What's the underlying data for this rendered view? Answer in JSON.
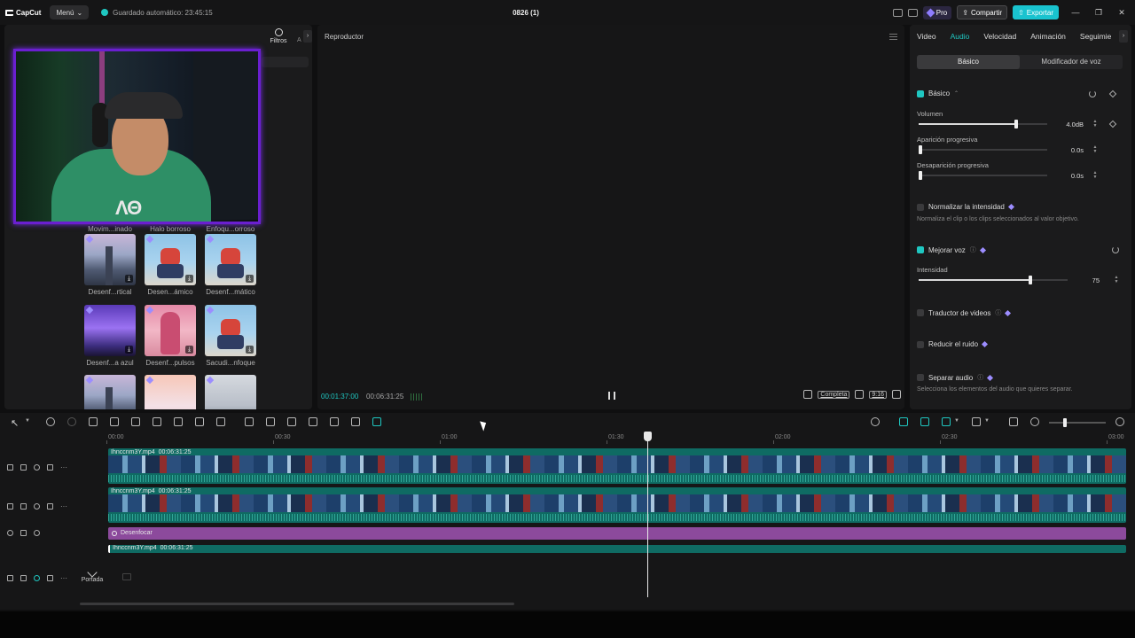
{
  "topbar": {
    "logo_text": "CapCut",
    "menu_label": "Menú",
    "autosave_text": "Guardado automático: 23:45:15",
    "project_title": "0826 (1)",
    "pro_label": "Pro",
    "share_label": "Compartir",
    "export_label": "Exportar"
  },
  "left_panel": {
    "filters_tab": "Filtros",
    "next_tab_initial": "A",
    "effects": [
      {
        "label": "Movim...inado",
        "style": "t-focus"
      },
      {
        "label": "Halo borroso",
        "style": "t-halo"
      },
      {
        "label": "Enfoqu...orroso",
        "style": "t-focus"
      },
      {
        "label": "Desenf...rtical",
        "style": "t-city"
      },
      {
        "label": "Desen...ámico",
        "style": "t-boy"
      },
      {
        "label": "Desenf...mático",
        "style": "t-boy"
      },
      {
        "label": "Desenf...a azul",
        "style": "t-crowd"
      },
      {
        "label": "Desenf...pulsos",
        "style": "t-girl"
      },
      {
        "label": "Sacudi...nfoque",
        "style": "t-boy"
      },
      {
        "label": "",
        "style": "t-city"
      },
      {
        "label": "",
        "style": "t-sunset"
      },
      {
        "label": "",
        "style": "t-room"
      }
    ],
    "hoodie_text": "ΛΘ"
  },
  "player": {
    "title": "Reproductor",
    "current_time": "00:01:37:00",
    "total_time": "00:06:31:25",
    "full_label": "Completa",
    "ratio_label": "9:16"
  },
  "right_panel": {
    "tabs": [
      "Video",
      "Audio",
      "Velocidad",
      "Animación",
      "Seguimie"
    ],
    "active_tab": "Audio",
    "segments": [
      "Básico",
      "Modificador de voz"
    ],
    "basic_section": "Básico",
    "volume_label": "Volumen",
    "volume_value": "4.0dB",
    "volume_level": 0.76,
    "fade_in_label": "Aparición progresiva",
    "fade_in_value": "0.0s",
    "fade_out_label": "Desaparición progresiva",
    "fade_out_value": "0.0s",
    "normalize_label": "Normalizar la intensidad",
    "normalize_desc": "Normaliza el clip o los clips seleccionados al valor objetivo.",
    "enhance_label": "Mejorar voz",
    "intensity_label": "Intensidad",
    "intensity_value": "75",
    "intensity_level": 0.75,
    "translate_label": "Traductor de videos",
    "noise_label": "Reducir el ruido",
    "separate_label": "Separar audio",
    "separate_desc": "Selecciona los elementos del audio que quieres separar."
  },
  "timeline": {
    "ruler": [
      {
        "t": "00:00"
      },
      {
        "t": "00:30"
      },
      {
        "t": "01:00"
      },
      {
        "t": "01:30"
      },
      {
        "t": "02:00"
      },
      {
        "t": "02:30"
      },
      {
        "t": "03:00"
      }
    ],
    "clip_name": "Ihnccnm3Y.mp4",
    "clip_duration": "00:06:31:25",
    "effect_name": "Desenfocar",
    "cover_label": "Portada"
  },
  "colors": {
    "accent": "#1fc7c1",
    "webcam_border": "#6a1fd0",
    "effect_clip": "#8c4a9c",
    "video_clip": "#0f6b63"
  }
}
